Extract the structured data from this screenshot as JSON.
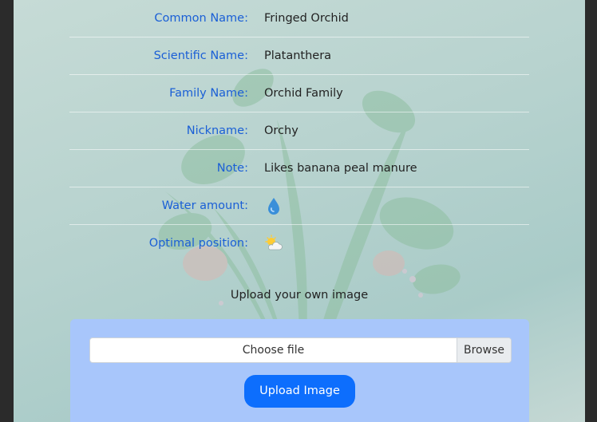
{
  "details": [
    {
      "label": "Common Name:",
      "value": "Fringed Orchid"
    },
    {
      "label": "Scientific Name:",
      "value": "Platanthera"
    },
    {
      "label": "Family Name:",
      "value": "Orchid Family"
    },
    {
      "label": "Nickname:",
      "value": "Orchy"
    },
    {
      "label": "Note:",
      "value": "Likes banana peal manure"
    }
  ],
  "water": {
    "label": "Water amount:",
    "icon": "water-drop-icon"
  },
  "position": {
    "label": "Optimal position:",
    "icon": "sun-behind-cloud-icon"
  },
  "upload": {
    "title": "Upload your own image",
    "file_placeholder": "Choose file",
    "browse_label": "Browse",
    "button_label": "Upload Image"
  },
  "colors": {
    "label": "#1a5fd6",
    "button": "#0d6efd",
    "upload_box": "#a8c6fb"
  }
}
